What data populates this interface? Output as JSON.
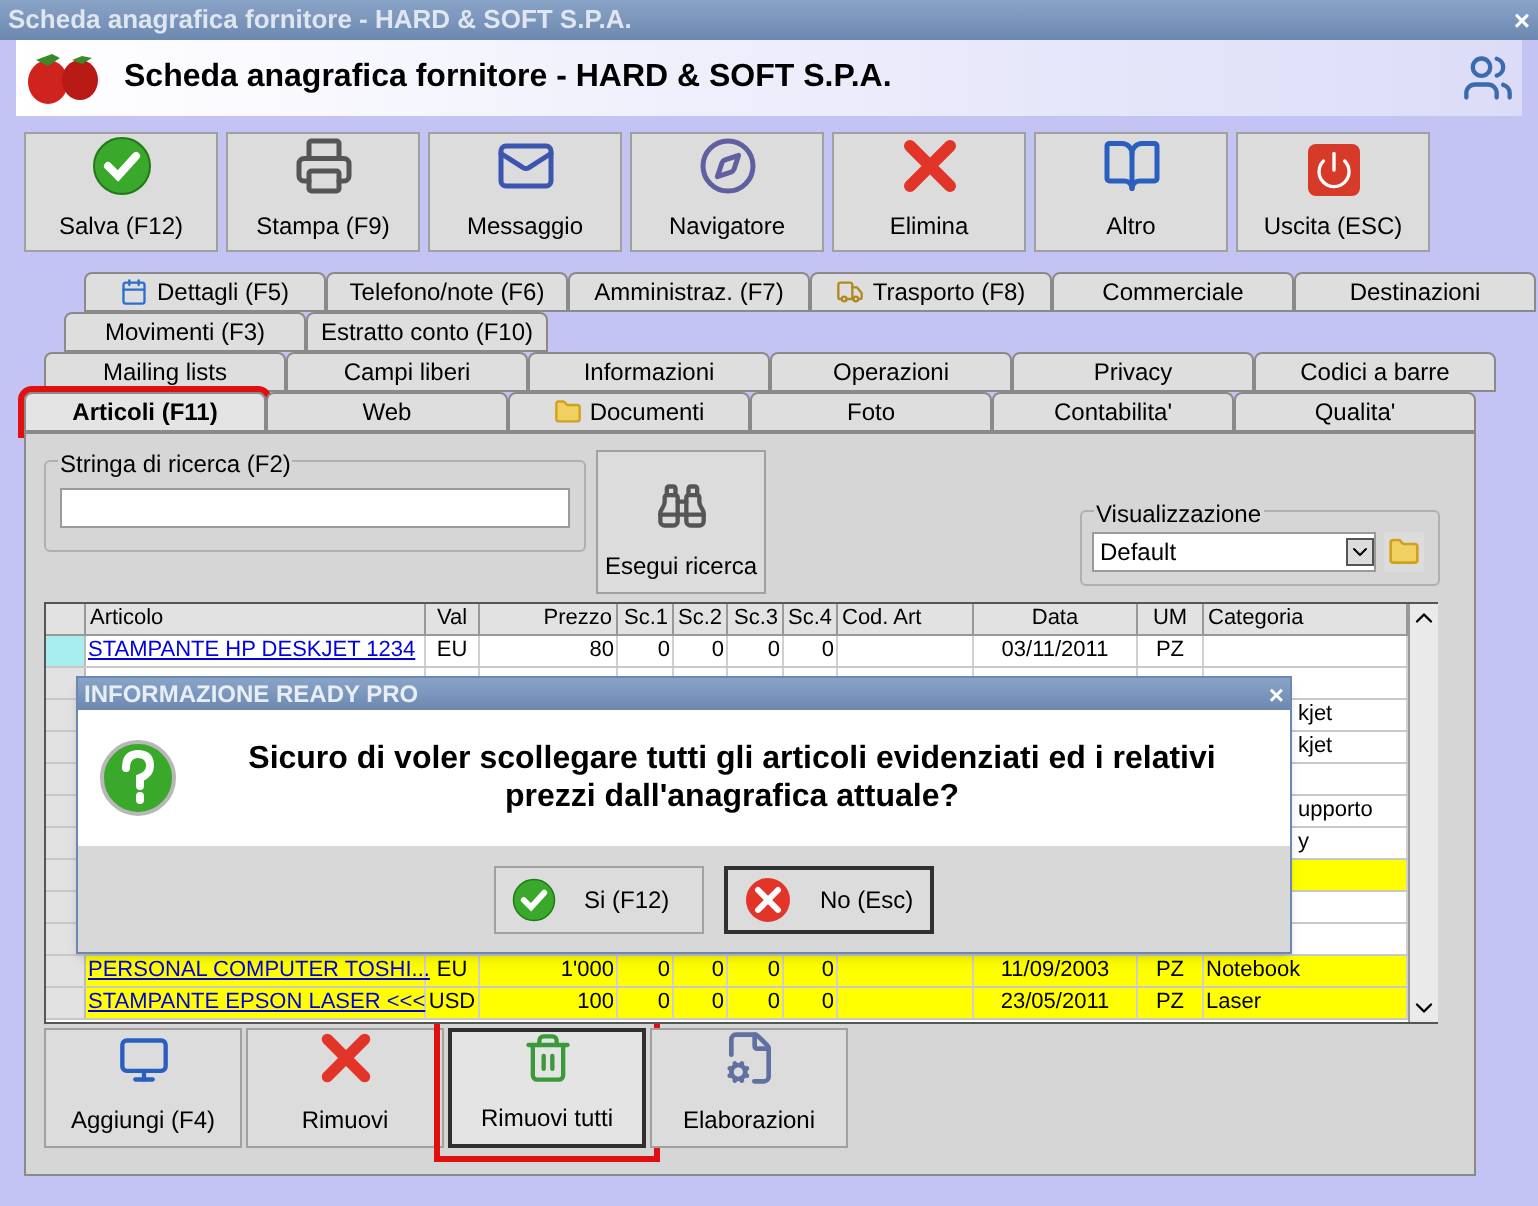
{
  "window": {
    "title": "Scheda anagrafica fornitore - HARD & SOFT S.P.A.",
    "close": "×"
  },
  "header": {
    "title": "Scheda anagrafica fornitore - HARD & SOFT S.P.A."
  },
  "toolbar": [
    {
      "label": "Salva (F12)"
    },
    {
      "label": "Stampa (F9)"
    },
    {
      "label": "Messaggio"
    },
    {
      "label": "Navigatore"
    },
    {
      "label": "Elimina"
    },
    {
      "label": "Altro"
    },
    {
      "label": "Uscita (ESC)"
    }
  ],
  "tab_rows": [
    [
      {
        "label": "Dettagli (F5)",
        "selected": false
      },
      {
        "label": "Telefono/note (F6)",
        "selected": false
      },
      {
        "label": "Amministraz. (F7)",
        "selected": false
      },
      {
        "label": "Trasporto (F8)",
        "selected": false
      },
      {
        "label": "Commerciale",
        "selected": false
      },
      {
        "label": "Destinazioni",
        "selected": false
      }
    ],
    [
      {
        "label": "Movimenti (F3)",
        "selected": false
      },
      {
        "label": "Estratto conto (F10)",
        "selected": false
      }
    ],
    [
      {
        "label": "Mailing lists",
        "selected": false
      },
      {
        "label": "Campi liberi",
        "selected": false
      },
      {
        "label": "Informazioni",
        "selected": false
      },
      {
        "label": "Operazioni",
        "selected": false
      },
      {
        "label": "Privacy",
        "selected": false
      },
      {
        "label": "Codici a barre",
        "selected": false
      }
    ],
    [
      {
        "label": "Articoli (F11)",
        "selected": true,
        "highlighted": true
      },
      {
        "label": "Web",
        "selected": false
      },
      {
        "label": "Documenti",
        "selected": false
      },
      {
        "label": "Foto",
        "selected": false
      },
      {
        "label": "Contabilita'",
        "selected": false
      },
      {
        "label": "Qualita'",
        "selected": false
      }
    ]
  ],
  "search": {
    "label": "Stringa di ricerca (F2)",
    "button": "Esegui ricerca"
  },
  "view": {
    "label": "Visualizzazione",
    "value": "Default"
  },
  "table": {
    "columns": [
      "Articolo",
      "Val",
      "Prezzo",
      "Sc.1",
      "Sc.2",
      "Sc.3",
      "Sc.4",
      "Cod. Art",
      "Data",
      "UM",
      "Categoria"
    ],
    "rows": [
      {
        "current": true,
        "highlighted": false,
        "articolo": "STAMPANTE HP DESKJET 1234",
        "val": "EU",
        "prezzo": "80",
        "sc1": "0",
        "sc2": "0",
        "sc3": "0",
        "sc4": "0",
        "data": "03/11/2011",
        "um": "PZ"
      },
      {
        "current": false,
        "highlighted": false
      },
      {
        "current": false,
        "highlighted": false,
        "clipped": true,
        "categoria": "kjet"
      },
      {
        "current": false,
        "highlighted": false,
        "clipped": true,
        "categoria": "kjet"
      },
      {
        "current": false,
        "highlighted": false
      },
      {
        "current": false,
        "highlighted": false,
        "clipped": true,
        "categoria": "upporto"
      },
      {
        "current": false,
        "highlighted": false,
        "clipped": true,
        "categoria": "y"
      },
      {
        "current": false,
        "highlighted": true
      },
      {
        "current": false,
        "highlighted": false
      },
      {
        "current": false,
        "highlighted": false
      },
      {
        "current": false,
        "highlighted": true,
        "articolo": "PERSONAL COMPUTER TOSHI...",
        "val": "EU",
        "prezzo": "1'000",
        "sc1": "0",
        "sc2": "0",
        "sc3": "0",
        "sc4": "0",
        "data": "11/09/2003",
        "um": "PZ",
        "categoria": "Notebook"
      },
      {
        "current": false,
        "highlighted": true,
        "articolo": "STAMPANTE EPSON LASER <<<",
        "val": "USD",
        "prezzo": "100",
        "sc1": "0",
        "sc2": "0",
        "sc3": "0",
        "sc4": "0",
        "data": "23/05/2011",
        "um": "PZ",
        "categoria": "Laser"
      }
    ]
  },
  "bottom_buttons": [
    {
      "label": "Aggiungi (F4)",
      "pressed": false,
      "highlighted": false
    },
    {
      "label": "Rimuovi",
      "pressed": false,
      "highlighted": false
    },
    {
      "label": "Rimuovi tutti",
      "pressed": true,
      "highlighted": true
    },
    {
      "label": "Elaborazioni",
      "pressed": false,
      "highlighted": false
    }
  ],
  "dialog": {
    "title": "INFORMAZIONE READY PRO",
    "close": "×",
    "message": "Sicuro di voler scollegare tutti gli articoli evidenziati ed i relativi prezzi dall'anagrafica attuale?",
    "buttons": [
      {
        "label": "Si (F12)",
        "kind": "yes",
        "focused": false
      },
      {
        "label": "No (Esc)",
        "kind": "no",
        "focused": true
      }
    ]
  }
}
